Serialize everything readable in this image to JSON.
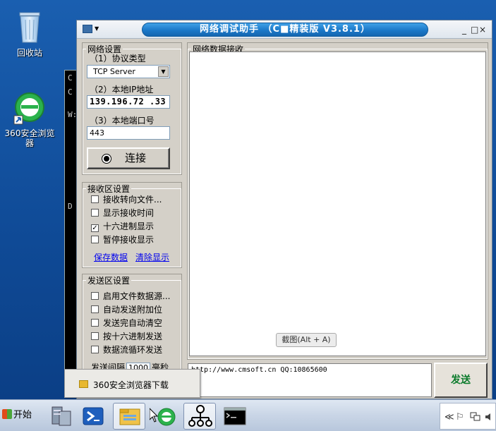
{
  "desktop": {
    "icons": [
      {
        "id": "recycle",
        "label": "回收站",
        "icon": "recycle-bin-icon"
      },
      {
        "id": "browser360",
        "label": "360安全浏览器",
        "icon": "360-browser-icon"
      }
    ]
  },
  "console_bg": {
    "chars": [
      "C",
      "C",
      "W:",
      "D"
    ]
  },
  "window": {
    "title": "网络调试助手 （C■精装版 V3.8.1）",
    "controls": {
      "minimize": "_",
      "maximize": "□",
      "close": "×"
    },
    "net_settings": {
      "legend": "网络设置",
      "protocol_label": "（1）协议类型",
      "protocol_value": "TCP Server",
      "ip_label": "（2）本地IP地址",
      "ip_value": "139.196.72 .33",
      "port_label": "（3）本地端口号",
      "port_value": "443",
      "connect_label": "连接"
    },
    "recv_settings": {
      "legend": "接收区设置",
      "options": [
        {
          "label": "接收转向文件...",
          "checked": false
        },
        {
          "label": "显示接收时间",
          "checked": false
        },
        {
          "label": "十六进制显示",
          "checked": true
        },
        {
          "label": "暂停接收显示",
          "checked": false
        }
      ],
      "save_link": "保存数据",
      "clear_link": "清除显示"
    },
    "send_settings": {
      "legend": "发送区设置",
      "options": [
        {
          "label": "启用文件数据源...",
          "checked": false
        },
        {
          "label": "自动发送附加位",
          "checked": false
        },
        {
          "label": "发送完自动清空",
          "checked": false
        },
        {
          "label": "按十六进制发送",
          "checked": false
        },
        {
          "label": "数据流循环发送",
          "checked": false
        }
      ],
      "interval_label": "发送间隔",
      "interval_value": "1000",
      "interval_unit": "毫秒"
    },
    "recv_area": {
      "legend": "网络数据接收",
      "screenshot_button": "截图(Alt + A)"
    },
    "send_area": {
      "value": "http://www.cmsoft.cn QQ:10865600",
      "send_button": "发送"
    }
  },
  "taskbar_popup": {
    "label": "360安全浏览器下载"
  },
  "taskbar": {
    "start_label": "开始",
    "tray": {
      "chevron": "≪",
      "flag": "⚐"
    }
  }
}
